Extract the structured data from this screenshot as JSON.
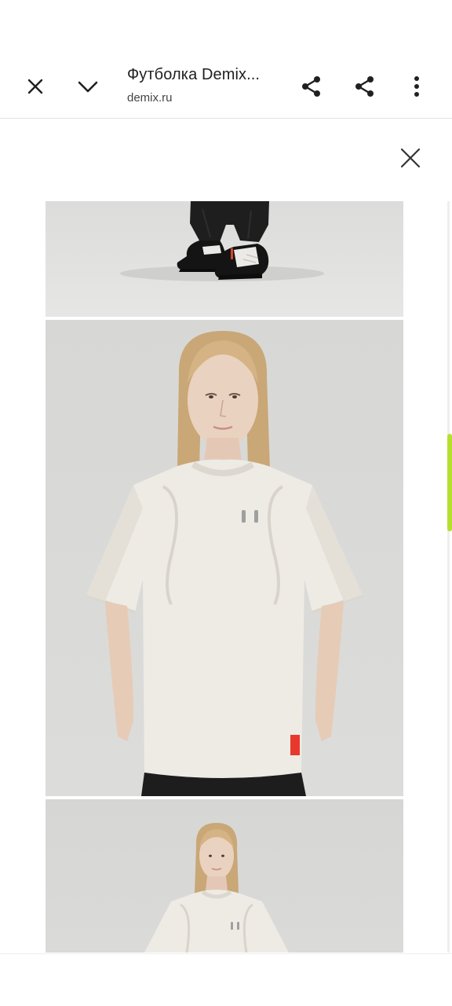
{
  "toolbar": {
    "title": "Футболка Demix...",
    "subtitle": "demix.ru",
    "icons": {
      "close": "close-icon",
      "collapse": "chevron-down-icon",
      "share_primary": "share-icon",
      "share_secondary": "share-icon",
      "more": "more-vert-icon"
    }
  },
  "viewer": {
    "close_icon": "close-icon",
    "images": [
      {
        "subject": "legs-sneakers-photo"
      },
      {
        "subject": "model-white-tshirt-photo"
      },
      {
        "subject": "model-white-tshirt-photo-2"
      }
    ]
  },
  "colors": {
    "accent_scrollbar": "#b6e02e",
    "tag_red": "#e8382b"
  }
}
